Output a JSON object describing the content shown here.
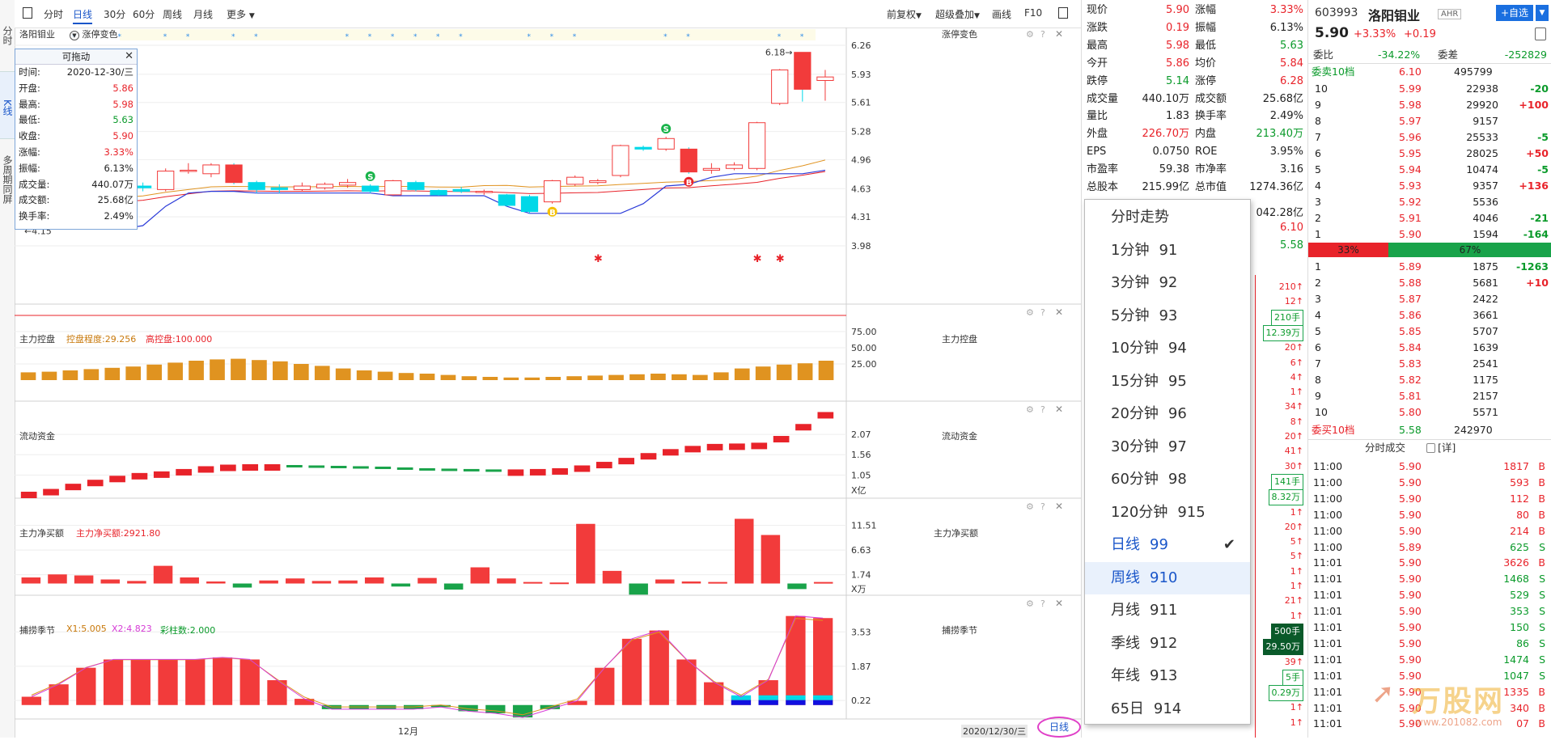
{
  "vtabs": [
    {
      "label": "分时",
      "active": false
    },
    {
      "label": "K线",
      "active": true
    },
    {
      "label": "多周期同屏",
      "active": false
    }
  ],
  "toolbar": {
    "left": [
      "分时",
      "日线",
      "30分",
      "60分",
      "周线",
      "月线",
      "更多"
    ],
    "active": "日线",
    "right": [
      "前复权",
      "超级叠加",
      "画线",
      "F10"
    ]
  },
  "main_header": {
    "stock_name": "洛阳钼业",
    "indicator": "涨停变色",
    "right_label": "涨停变色"
  },
  "infobox": {
    "title": "可拖动",
    "rows": [
      {
        "k": "时间:",
        "v": "2020-12-30/三",
        "c": "#222"
      },
      {
        "k": "开盘:",
        "v": "5.86",
        "c": "#e8232a"
      },
      {
        "k": "最高:",
        "v": "5.98",
        "c": "#e8232a"
      },
      {
        "k": "最低:",
        "v": "5.63",
        "c": "#0a9a2a"
      },
      {
        "k": "收盘:",
        "v": "5.90",
        "c": "#e8232a"
      },
      {
        "k": "涨幅:",
        "v": "3.33%",
        "c": "#e8232a"
      },
      {
        "k": "振幅:",
        "v": "6.13%",
        "c": "#222"
      },
      {
        "k": "成交量:",
        "v": "440.07万",
        "c": "#222"
      },
      {
        "k": "成交额:",
        "v": "25.68亿",
        "c": "#222"
      },
      {
        "k": "换手率:",
        "v": "2.49%",
        "c": "#222"
      }
    ]
  },
  "chart_data": [
    {
      "type": "candlestick",
      "title": "洛阳钼业",
      "y_ticks": [
        "6.26",
        "5.93",
        "5.61",
        "5.28",
        "4.96",
        "4.63",
        "4.31",
        "3.98"
      ],
      "ylim": [
        3.98,
        6.26
      ],
      "annotations": [
        "4.15",
        "6.18"
      ],
      "candles": [
        {
          "o": 4.2,
          "c": 4.25,
          "h": 4.28,
          "l": 4.17
        },
        {
          "o": 4.25,
          "c": 4.37,
          "h": 4.38,
          "l": 4.21
        },
        {
          "o": 4.45,
          "c": 4.75,
          "h": 4.78,
          "l": 4.43
        },
        {
          "o": 4.67,
          "c": 4.6,
          "h": 4.72,
          "l": 4.58
        },
        {
          "o": 4.62,
          "c": 4.68,
          "h": 4.72,
          "l": 4.6
        },
        {
          "o": 4.66,
          "c": 4.64,
          "h": 4.7,
          "l": 4.6
        },
        {
          "o": 4.62,
          "c": 4.83,
          "h": 4.86,
          "l": 4.6
        },
        {
          "o": 4.84,
          "c": 4.84,
          "h": 4.92,
          "l": 4.8
        },
        {
          "o": 4.8,
          "c": 4.9,
          "h": 4.92,
          "l": 4.76
        },
        {
          "o": 4.9,
          "c": 4.7,
          "h": 4.92,
          "l": 4.68
        },
        {
          "o": 4.7,
          "c": 4.62,
          "h": 4.72,
          "l": 4.58
        },
        {
          "o": 4.64,
          "c": 4.62,
          "h": 4.68,
          "l": 4.58
        },
        {
          "o": 4.62,
          "c": 4.66,
          "h": 4.7,
          "l": 4.6
        },
        {
          "o": 4.64,
          "c": 4.68,
          "h": 4.7,
          "l": 4.62
        },
        {
          "o": 4.67,
          "c": 4.7,
          "h": 4.74,
          "l": 4.64
        },
        {
          "o": 4.66,
          "c": 4.6,
          "h": 4.68,
          "l": 4.58
        },
        {
          "o": 4.56,
          "c": 4.72,
          "h": 4.73,
          "l": 4.55
        },
        {
          "o": 4.7,
          "c": 4.62,
          "h": 4.72,
          "l": 4.6
        },
        {
          "o": 4.61,
          "c": 4.56,
          "h": 4.62,
          "l": 4.55
        },
        {
          "o": 4.62,
          "c": 4.6,
          "h": 4.65,
          "l": 4.58
        },
        {
          "o": 4.6,
          "c": 4.6,
          "h": 4.62,
          "l": 4.56
        },
        {
          "o": 4.56,
          "c": 4.44,
          "h": 4.57,
          "l": 4.43
        },
        {
          "o": 4.54,
          "c": 4.37,
          "h": 4.56,
          "l": 4.35
        },
        {
          "o": 4.48,
          "c": 4.72,
          "h": 4.73,
          "l": 4.46
        },
        {
          "o": 4.68,
          "c": 4.76,
          "h": 4.78,
          "l": 4.66
        },
        {
          "o": 4.7,
          "c": 4.72,
          "h": 4.74,
          "l": 4.68
        },
        {
          "o": 4.78,
          "c": 5.12,
          "h": 5.13,
          "l": 4.76
        },
        {
          "o": 5.1,
          "c": 5.08,
          "h": 5.12,
          "l": 5.06
        },
        {
          "o": 5.08,
          "c": 5.2,
          "h": 5.22,
          "l": 5.06
        },
        {
          "o": 5.08,
          "c": 4.82,
          "h": 5.1,
          "l": 4.8
        },
        {
          "o": 4.84,
          "c": 4.86,
          "h": 4.92,
          "l": 4.8
        },
        {
          "o": 4.86,
          "c": 4.9,
          "h": 4.93,
          "l": 4.84
        },
        {
          "o": 4.86,
          "c": 5.38,
          "h": 5.39,
          "l": 4.84
        },
        {
          "o": 5.6,
          "c": 5.98,
          "h": 5.99,
          "l": 5.58
        },
        {
          "o": 6.18,
          "c": 5.76,
          "h": 6.18,
          "l": 5.62
        },
        {
          "o": 5.86,
          "c": 5.9,
          "h": 5.98,
          "l": 5.63
        }
      ],
      "signals": [
        {
          "i": 15,
          "label": "S"
        },
        {
          "i": 23,
          "label": "B"
        },
        {
          "i": 28,
          "label": "S"
        },
        {
          "i": 29,
          "label": "B"
        }
      ]
    },
    {
      "type": "bar",
      "title": "主力控盘",
      "legend": [
        {
          "name": "控盘程度",
          "value": "29.256",
          "color": "#c8780a"
        },
        {
          "name": "高控盘",
          "value": "100.000",
          "color": "#e8232a"
        }
      ],
      "y_ticks": [
        "75.00",
        "50.00",
        "25.00"
      ],
      "ylim": [
        0,
        100
      ],
      "values": [
        12,
        13,
        15,
        17,
        19,
        21,
        24,
        27,
        30,
        32,
        33,
        31,
        29,
        25,
        22,
        18,
        15,
        13,
        11,
        10,
        8,
        6,
        5,
        4,
        4,
        5,
        6,
        7,
        8,
        9,
        10,
        9,
        8,
        12,
        18,
        21,
        24,
        26,
        30
      ]
    },
    {
      "type": "bar",
      "title": "流动资金",
      "y_ticks": [
        "2.07",
        "1.56",
        "1.05"
      ],
      "y_unit": "X亿",
      "ylim": [
        0.55,
        2.58
      ],
      "values": [
        0.55,
        0.62,
        0.75,
        0.85,
        0.95,
        1.02,
        1.06,
        1.12,
        1.19,
        1.23,
        1.24,
        1.24,
        1.22,
        1.21,
        1.2,
        1.19,
        1.18,
        1.16,
        1.14,
        1.13,
        1.12,
        1.11,
        1.11,
        1.12,
        1.14,
        1.21,
        1.3,
        1.4,
        1.52,
        1.62,
        1.7,
        1.75,
        1.76,
        1.78,
        1.95,
        2.25,
        2.55
      ]
    },
    {
      "type": "bar",
      "title": "主力净买额",
      "legend": [
        {
          "name": "主力净买额",
          "value": "2921.80",
          "color": "#e8232a"
        }
      ],
      "y_ticks": [
        "11.51",
        "6.63",
        "1.74"
      ],
      "y_unit": "X万",
      "ylim": [
        -2,
        14
      ],
      "values": [
        1.2,
        1.8,
        1.6,
        0.8,
        0.5,
        3.5,
        1.2,
        0.4,
        -0.8,
        0.6,
        1.0,
        0.5,
        0.6,
        1.2,
        -0.6,
        1.1,
        -1.2,
        3.2,
        1.0,
        0.3,
        0.2,
        11.8,
        2.5,
        -2.2,
        0.8,
        0.4,
        0.3,
        12.8,
        9.6,
        -1.1,
        0.3
      ]
    },
    {
      "type": "bar",
      "title": "捕捞季节",
      "legend": [
        {
          "name": "X1",
          "value": "5.005",
          "color": "#c8780a"
        },
        {
          "name": "X2",
          "value": "4.823",
          "color": "#d63bd6"
        },
        {
          "name": "彩柱数",
          "value": "2.000",
          "color": "#0a9a2a"
        }
      ],
      "y_ticks": [
        "3.53",
        "1.87",
        "0.22"
      ],
      "ylim": [
        -0.4,
        4.6
      ],
      "values": [
        0.4,
        1.0,
        1.8,
        2.2,
        2.2,
        2.2,
        2.2,
        2.3,
        2.2,
        1.2,
        0.3,
        -0.2,
        -0.2,
        -0.2,
        -0.2,
        -0.1,
        -0.3,
        -0.4,
        -0.6,
        -0.2,
        0.2,
        1.8,
        3.2,
        3.6,
        2.2,
        1.1,
        0.4,
        1.2,
        4.3,
        4.2
      ]
    }
  ],
  "xaxis": {
    "month_label": "12月",
    "date_label": "2020/12/30/三",
    "period_button": "日线"
  },
  "dropdown": {
    "items": [
      {
        "label": "分时走势",
        "code": ""
      },
      {
        "label": "1分钟",
        "code": "91"
      },
      {
        "label": "3分钟",
        "code": "92"
      },
      {
        "label": "5分钟",
        "code": "93"
      },
      {
        "label": "10分钟",
        "code": "94"
      },
      {
        "label": "15分钟",
        "code": "95"
      },
      {
        "label": "20分钟",
        "code": "96"
      },
      {
        "label": "30分钟",
        "code": "97"
      },
      {
        "label": "60分钟",
        "code": "98"
      },
      {
        "label": "120分钟",
        "code": "915"
      },
      {
        "label": "日线",
        "code": "99"
      },
      {
        "label": "周线",
        "code": "910"
      },
      {
        "label": "月线",
        "code": "911"
      },
      {
        "label": "季线",
        "code": "912"
      },
      {
        "label": "年线",
        "code": "913"
      },
      {
        "label": "65日",
        "code": "914"
      }
    ],
    "selected": "日线",
    "hover": "周线"
  },
  "quote": {
    "rows": [
      [
        {
          "k": "现价",
          "v": "5.90",
          "c": "red"
        },
        {
          "k": "涨幅",
          "v": "3.33%",
          "c": "red"
        }
      ],
      [
        {
          "k": "涨跌",
          "v": "0.19",
          "c": "red"
        },
        {
          "k": "振幅",
          "v": "6.13%",
          "c": ""
        }
      ],
      [
        {
          "k": "最高",
          "v": "5.98",
          "c": "red"
        },
        {
          "k": "最低",
          "v": "5.63",
          "c": "green"
        }
      ],
      [
        {
          "k": "今开",
          "v": "5.86",
          "c": "red"
        },
        {
          "k": "均价",
          "v": "5.84",
          "c": "red"
        }
      ],
      [
        {
          "k": "跌停",
          "v": "5.14",
          "c": "green"
        },
        {
          "k": "涨停",
          "v": "6.28",
          "c": "red"
        }
      ],
      [
        {
          "k": "成交量",
          "v": "440.10万",
          "c": ""
        },
        {
          "k": "成交额",
          "v": "25.68亿",
          "c": ""
        }
      ],
      [
        {
          "k": "量比",
          "v": "1.83",
          "c": ""
        },
        {
          "k": "换手率",
          "v": "2.49%",
          "c": ""
        }
      ],
      [
        {
          "k": "外盘",
          "v": "226.70万",
          "c": "red"
        },
        {
          "k": "内盘",
          "v": "213.40万",
          "c": "green"
        }
      ],
      [
        {
          "k": "EPS",
          "v": "0.0750",
          "c": ""
        },
        {
          "k": "ROE",
          "v": "3.95%",
          "c": ""
        }
      ],
      [
        {
          "k": "市盈率",
          "v": "59.38",
          "c": ""
        },
        {
          "k": "市净率",
          "v": "3.16",
          "c": ""
        }
      ],
      [
        {
          "k": "总股本",
          "v": "215.99亿",
          "c": ""
        },
        {
          "k": "总市值",
          "v": "1274.36亿",
          "c": ""
        }
      ]
    ],
    "partial_right": [
      {
        "v": "042.28亿",
        "c": ""
      },
      {
        "v": "6.10",
        "c": "red"
      },
      {
        "v": "5.58",
        "c": "green"
      }
    ],
    "ticks_right": [
      {
        "v": "210↑",
        "c": "red"
      },
      {
        "v": "12↑",
        "c": "red"
      },
      {
        "v": "210手",
        "c": "green",
        "box": true
      },
      {
        "v": "12.39万",
        "c": "green",
        "box": true
      },
      {
        "v": "20↑",
        "c": "red"
      },
      {
        "v": "6↑",
        "c": "red"
      },
      {
        "v": "4↑",
        "c": "red"
      },
      {
        "v": "1↑",
        "c": "red"
      },
      {
        "v": "34↑",
        "c": "red"
      },
      {
        "v": "8↑",
        "c": "red"
      },
      {
        "v": "20↑",
        "c": "red"
      },
      {
        "v": "41↑",
        "c": "red"
      },
      {
        "v": "30↑",
        "c": "red"
      },
      {
        "v": "141手",
        "c": "green",
        "box": true
      },
      {
        "v": "8.32万",
        "c": "green",
        "box": true
      },
      {
        "v": "1↑",
        "c": "red"
      },
      {
        "v": "20↑",
        "c": "red"
      },
      {
        "v": "5↑",
        "c": "red"
      },
      {
        "v": "5↑",
        "c": "red"
      },
      {
        "v": "1↑",
        "c": "red"
      },
      {
        "v": "1↑",
        "c": "red"
      },
      {
        "v": "21↑",
        "c": "red"
      },
      {
        "v": "1↑",
        "c": "red"
      },
      {
        "v": "500手",
        "c": "white",
        "box": true,
        "dark": true
      },
      {
        "v": "29.50万",
        "c": "white",
        "box": true,
        "dark": true
      },
      {
        "v": "39↑",
        "c": "red"
      },
      {
        "v": "5手",
        "c": "green",
        "box": true
      },
      {
        "v": "0.29万",
        "c": "green",
        "box": true
      },
      {
        "v": "1↑",
        "c": "red"
      },
      {
        "v": "1↑",
        "c": "red"
      }
    ]
  },
  "depth": {
    "code": "603993",
    "name": "洛阳钼业",
    "badge": "AHR",
    "add_button": "+自选",
    "price": "5.90",
    "pct": "+3.33%",
    "chg": "+0.19",
    "webi_label": "委比",
    "webi_val": "-34.22%",
    "wecha_label": "委差",
    "wecha_val": "-252829",
    "sell_header": "委卖10档",
    "sell_header_price": "6.10",
    "sell_header_vol": "495799",
    "sells": [
      {
        "lv": "10",
        "p": "5.99",
        "v": "22938",
        "d": "-20",
        "dc": "green"
      },
      {
        "lv": "9",
        "p": "5.98",
        "v": "29920",
        "d": "+100",
        "dc": "red"
      },
      {
        "lv": "8",
        "p": "5.97",
        "v": "9157",
        "d": "",
        "dc": ""
      },
      {
        "lv": "7",
        "p": "5.96",
        "v": "25533",
        "d": "-5",
        "dc": "green"
      },
      {
        "lv": "6",
        "p": "5.95",
        "v": "28025",
        "d": "+50",
        "dc": "red"
      },
      {
        "lv": "5",
        "p": "5.94",
        "v": "10474",
        "d": "-5",
        "dc": "green"
      },
      {
        "lv": "4",
        "p": "5.93",
        "v": "9357",
        "d": "+136",
        "dc": "red"
      },
      {
        "lv": "3",
        "p": "5.92",
        "v": "5536",
        "d": "",
        "dc": ""
      },
      {
        "lv": "2",
        "p": "5.91",
        "v": "4046",
        "d": "-21",
        "dc": "green"
      },
      {
        "lv": "1",
        "p": "5.90",
        "v": "1594",
        "d": "-164",
        "dc": "green"
      }
    ],
    "ratio_left": "33%",
    "ratio_right": "67%",
    "ratio_left_value": 0.33,
    "buys": [
      {
        "lv": "1",
        "p": "5.89",
        "v": "1875",
        "d": "-1263",
        "dc": "green"
      },
      {
        "lv": "2",
        "p": "5.88",
        "v": "5681",
        "d": "+10",
        "dc": "red"
      },
      {
        "lv": "3",
        "p": "5.87",
        "v": "2422",
        "d": "",
        "dc": ""
      },
      {
        "lv": "4",
        "p": "5.86",
        "v": "3661",
        "d": "",
        "dc": ""
      },
      {
        "lv": "5",
        "p": "5.85",
        "v": "5707",
        "d": "",
        "dc": ""
      },
      {
        "lv": "6",
        "p": "5.84",
        "v": "1639",
        "d": "",
        "dc": ""
      },
      {
        "lv": "7",
        "p": "5.83",
        "v": "2541",
        "d": "",
        "dc": ""
      },
      {
        "lv": "8",
        "p": "5.82",
        "v": "1175",
        "d": "",
        "dc": ""
      },
      {
        "lv": "9",
        "p": "5.81",
        "v": "2157",
        "d": "",
        "dc": ""
      },
      {
        "lv": "10",
        "p": "5.80",
        "v": "5571",
        "d": "",
        "dc": ""
      }
    ],
    "buy_header": "委买10档",
    "buy_header_price": "5.58",
    "buy_header_vol": "242970",
    "trades_title": "分时成交",
    "trades_detail": "[详]",
    "trades": [
      {
        "t": "11:00",
        "p": "5.90",
        "v": "1817",
        "s": "B"
      },
      {
        "t": "11:00",
        "p": "5.90",
        "v": "593",
        "s": "B"
      },
      {
        "t": "11:00",
        "p": "5.90",
        "v": "112",
        "s": "B"
      },
      {
        "t": "11:00",
        "p": "5.90",
        "v": "80",
        "s": "B"
      },
      {
        "t": "11:00",
        "p": "5.90",
        "v": "214",
        "s": "B"
      },
      {
        "t": "11:00",
        "p": "5.89",
        "v": "625",
        "s": "S"
      },
      {
        "t": "11:01",
        "p": "5.90",
        "v": "3626",
        "s": "B"
      },
      {
        "t": "11:01",
        "p": "5.90",
        "v": "1468",
        "s": "S"
      },
      {
        "t": "11:01",
        "p": "5.90",
        "v": "529",
        "s": "S"
      },
      {
        "t": "11:01",
        "p": "5.90",
        "v": "353",
        "s": "S"
      },
      {
        "t": "11:01",
        "p": "5.90",
        "v": "150",
        "s": "S"
      },
      {
        "t": "11:01",
        "p": "5.90",
        "v": "86",
        "s": "S"
      },
      {
        "t": "11:01",
        "p": "5.90",
        "v": "1474",
        "s": "S"
      },
      {
        "t": "11:01",
        "p": "5.90",
        "v": "1047",
        "s": "S"
      },
      {
        "t": "11:01",
        "p": "5.90",
        "v": "1335",
        "s": "B"
      },
      {
        "t": "11:01",
        "p": "5.90",
        "v": "340",
        "s": "B"
      },
      {
        "t": "11:01",
        "p": "5.90",
        "v": "07",
        "s": "B"
      }
    ],
    "watermark": "万股网",
    "watermark_url": "www.201082.com"
  },
  "colors": {
    "up": "#f23b3b",
    "down": "#00b8c8",
    "accent": "#1a56c9",
    "orange": "#e09320"
  }
}
